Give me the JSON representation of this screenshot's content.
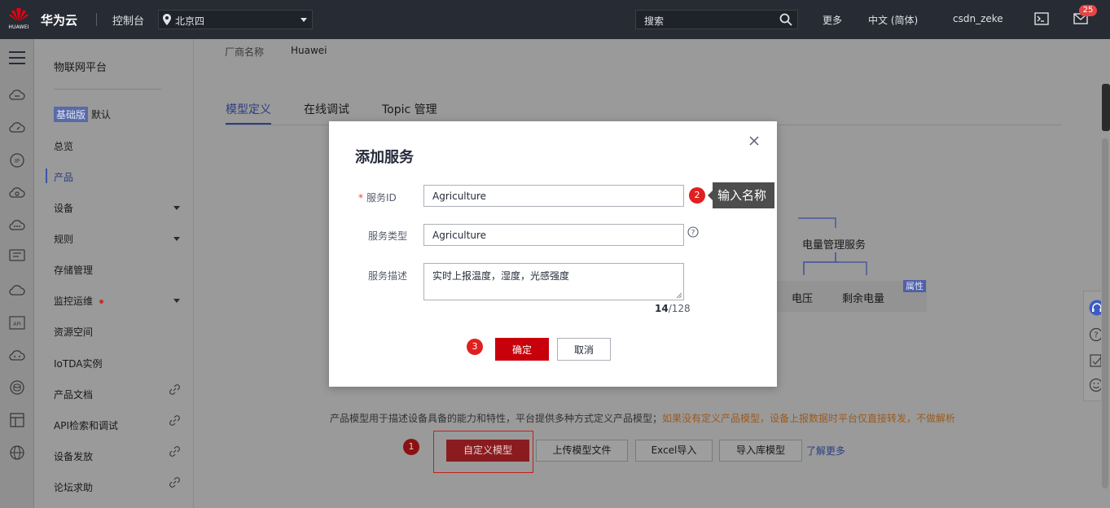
{
  "topbar": {
    "logo_text": "HUAWEI",
    "brand": "华为云",
    "console": "控制台",
    "region": "北京四",
    "search_placeholder": "搜索",
    "more": "更多",
    "language": "中文 (简体)",
    "user": "csdn_zeke",
    "notification_count": "25"
  },
  "sidebar": {
    "title": "物联网平台",
    "edition_tag": "基础版",
    "edition_default": "默认",
    "items": [
      {
        "label": "总览"
      },
      {
        "label": "产品"
      },
      {
        "label": "设备"
      },
      {
        "label": "规则"
      },
      {
        "label": "存储管理"
      },
      {
        "label": "监控运维"
      },
      {
        "label": "资源空间"
      },
      {
        "label": "IoTDA实例"
      },
      {
        "label": "产品文档"
      },
      {
        "label": "API检索和调试"
      },
      {
        "label": "设备发放"
      },
      {
        "label": "论坛求助"
      }
    ]
  },
  "main": {
    "vendor_label": "厂商名称",
    "vendor_value": "Huawei",
    "tabs": [
      {
        "label": "模型定义"
      },
      {
        "label": "在线调试"
      },
      {
        "label": "Topic 管理"
      }
    ],
    "tree": {
      "service": "电量管理服务",
      "leaves": [
        "电压",
        "剩余电量"
      ],
      "tag": "属性"
    },
    "description": "产品模型用于描述设备具备的能力和特性，平台提供多种方式定义产品模型；",
    "warning": "如果没有定义产品模型，设备上报数据时平台仅直接转发，不做解析",
    "buttons": {
      "custom": "自定义模型",
      "upload": "上传模型文件",
      "excel": "Excel导入",
      "import_lib": "导入库模型"
    },
    "learn_more": "了解更多"
  },
  "modal": {
    "title": "添加服务",
    "service_id_label": "服务ID",
    "service_id_value": "Agriculture",
    "service_type_label": "服务类型",
    "service_type_value": "Agriculture",
    "service_desc_label": "服务描述",
    "service_desc_value": "实时上报温度，湿度，光感强度",
    "counter_current": "14",
    "counter_max": "/128",
    "ok": "确定",
    "cancel": "取消"
  },
  "tooltip": "输入名称",
  "steps": [
    "1",
    "2",
    "3"
  ],
  "colors": {
    "accent_red": "#c7000b",
    "topbar_bg": "#272b33",
    "link_blue": "#526ecc"
  }
}
